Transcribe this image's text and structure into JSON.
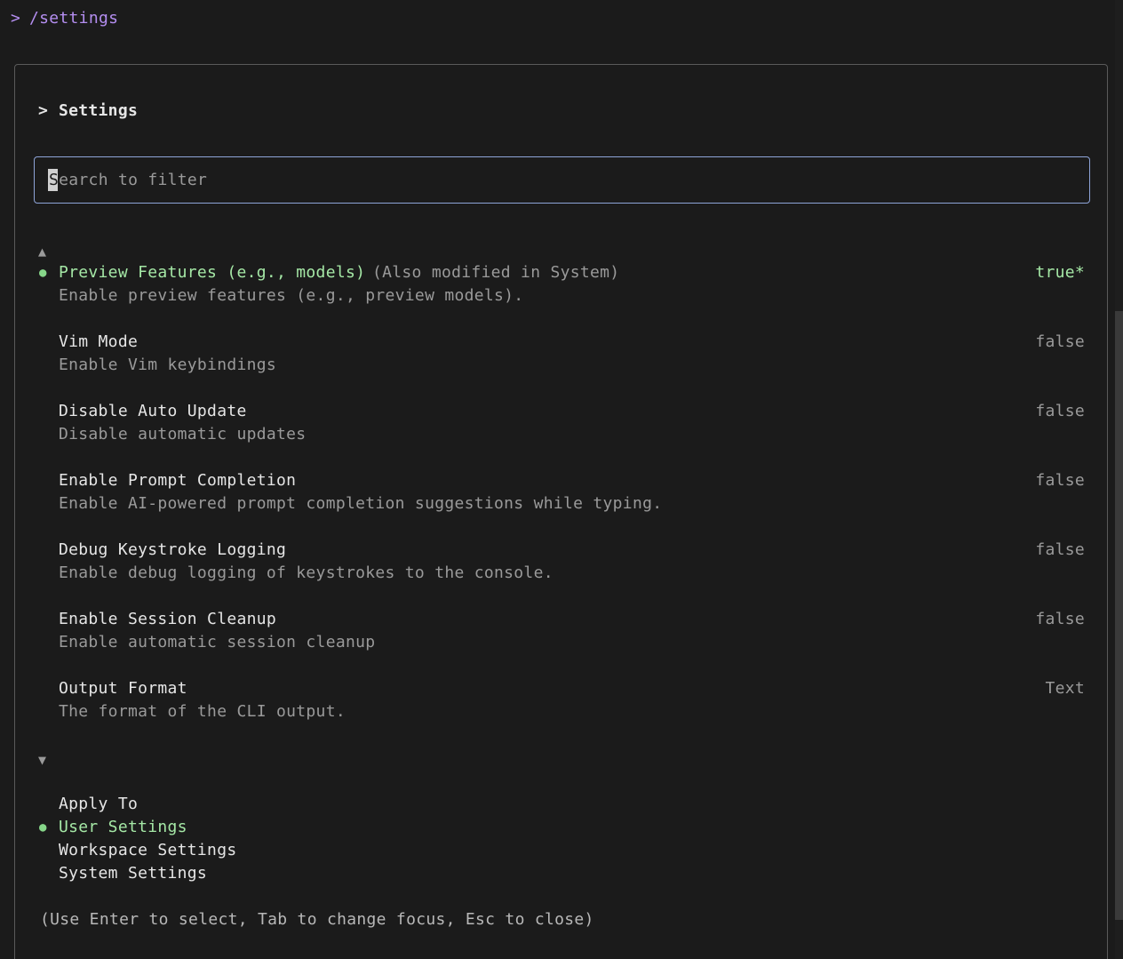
{
  "command": {
    "prompt": ">",
    "text": "/settings"
  },
  "dialog": {
    "title_caret": ">",
    "title": "Settings",
    "search": {
      "placeholder_first": "S",
      "placeholder_rest": "earch to filter",
      "value": ""
    },
    "scroll_up_indicator": "▲",
    "scroll_down_indicator": "▼",
    "items": [
      {
        "label": "Preview Features (e.g., models)",
        "scope": "(Also modified in System)",
        "description": "Enable preview features (e.g., preview models).",
        "value": "true*",
        "selected": true
      },
      {
        "label": "Vim Mode",
        "scope": "",
        "description": "Enable Vim keybindings",
        "value": "false",
        "selected": false
      },
      {
        "label": "Disable Auto Update",
        "scope": "",
        "description": "Disable automatic updates",
        "value": "false",
        "selected": false
      },
      {
        "label": "Enable Prompt Completion",
        "scope": "",
        "description": "Enable AI-powered prompt completion suggestions while typing.",
        "value": "false",
        "selected": false
      },
      {
        "label": "Debug Keystroke Logging",
        "scope": "",
        "description": "Enable debug logging of keystrokes to the console.",
        "value": "false",
        "selected": false
      },
      {
        "label": "Enable Session Cleanup",
        "scope": "",
        "description": "Enable automatic session cleanup",
        "value": "false",
        "selected": false
      },
      {
        "label": "Output Format",
        "scope": "",
        "description": "The format of the CLI output.",
        "value": "Text",
        "selected": false
      }
    ],
    "apply_to": {
      "heading": "Apply To",
      "options": [
        {
          "label": "User Settings",
          "selected": true
        },
        {
          "label": "Workspace Settings",
          "selected": false
        },
        {
          "label": "System Settings",
          "selected": false
        }
      ]
    },
    "bullet": "●",
    "hint": "(Use Enter to select, Tab to change focus, Esc to close)"
  },
  "colors": {
    "background": "#1b1b1b",
    "command": "#b48ef0",
    "accent_green": "#a5e8a6",
    "search_border": "#8ea4d8",
    "muted": "#9a9a9a"
  }
}
